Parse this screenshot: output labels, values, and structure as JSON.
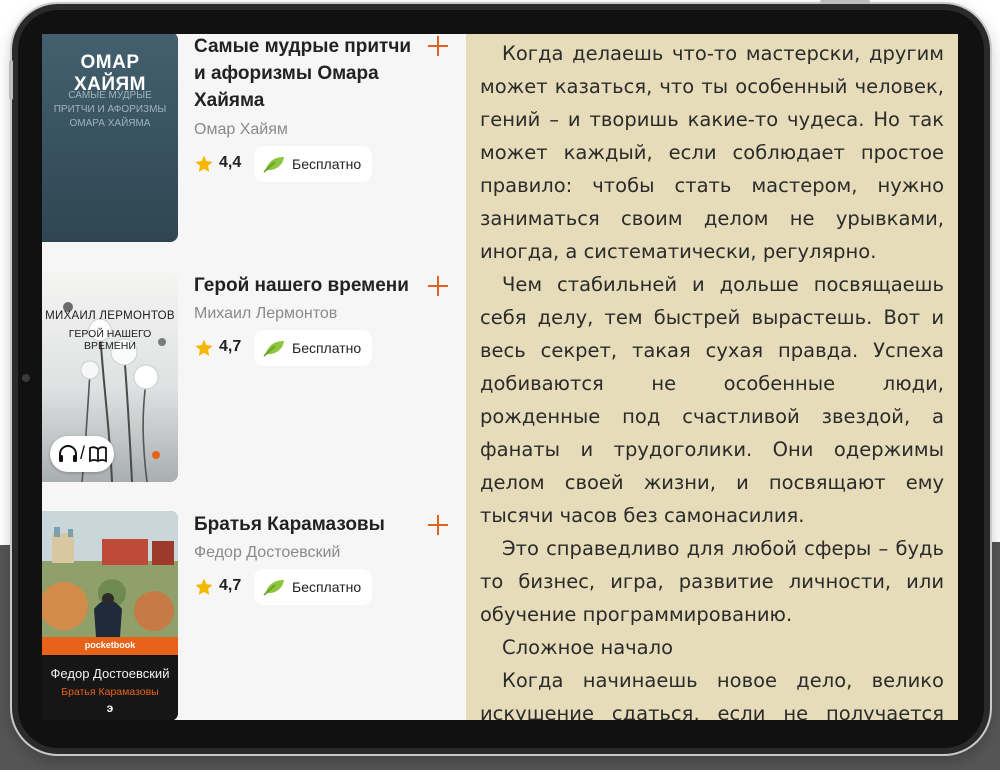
{
  "library": {
    "books": [
      {
        "title": "Самые мудрые притчи и афоризмы Омара Хайяма",
        "author": "Омар Хайям",
        "rating": "4,4",
        "price": "Бесплатно",
        "cover": {
          "author": "ОМАР ХАЙЯМ",
          "title_lines": [
            "САМЫЕ МУДРЫЕ",
            "ПРИТЧИ И АФОРИЗМЫ",
            "ОМАРА ХАЙЯМА"
          ],
          "color": "#3e5664"
        }
      },
      {
        "title": "Герой нашего времени",
        "author": "Михаил Лермонтов",
        "rating": "4,7",
        "price": "Бесплатно",
        "cover": {
          "author": "МИХАИЛ ЛЕРМОНТОВ",
          "title": "ГЕРОЙ НАШЕГО ВРЕМЕНИ",
          "badge_separator": "/",
          "badge_icons": [
            "headphones-icon",
            "book-icon"
          ]
        }
      },
      {
        "title": "Братья Карамазовы",
        "author": "Федор Достоевский",
        "rating": "4,7",
        "price": "Бесплатно",
        "cover": {
          "series": "pocketbook",
          "author": "Федор Достоевский",
          "title": "Братья Карамазовы",
          "publisher_mark": "э",
          "color": "#e8621a"
        }
      }
    ],
    "icons": {
      "add": "plus-icon",
      "rating": "star-icon",
      "price": "leaf-icon"
    },
    "colors": {
      "accent": "#e0621f",
      "star": "#f5b800",
      "leaf": "#8cc63f"
    }
  },
  "reader": {
    "background": "#e6dcb9",
    "paragraphs": [
      "Когда делаешь что-то мастерски, другим может казаться, что ты особенный человек, гений – и творишь какие-то чудеса. Но так может каждый, если соблюдает простое прави­ло: чтобы стать мастером, нужно заниматься своим делом не урывками, иногда, а системати­чески, регулярно.",
      "Чем стабильней и дольше посвящаешь себя делу, тем быстрей вырастешь. Вот и весь секрет, такая сухая правда. Успеха добиваются не осо­бенные люди, рожденные под счастливой звез­дой, а фанаты и трудоголики. Они одержимы делом своей жизни, и посвящают ему тысячи часов без самонасилия.",
      "Это справедливо для любой сферы – будь то бизнес, игра, развитие личности, или обучение программированию.",
      "Сложное начало",
      "Когда начинаешь новое дело, велико искуше­ние сдаться, если не получается сразу пре­успеть и показать класс. Но в любом деле нови­чок"
    ]
  }
}
